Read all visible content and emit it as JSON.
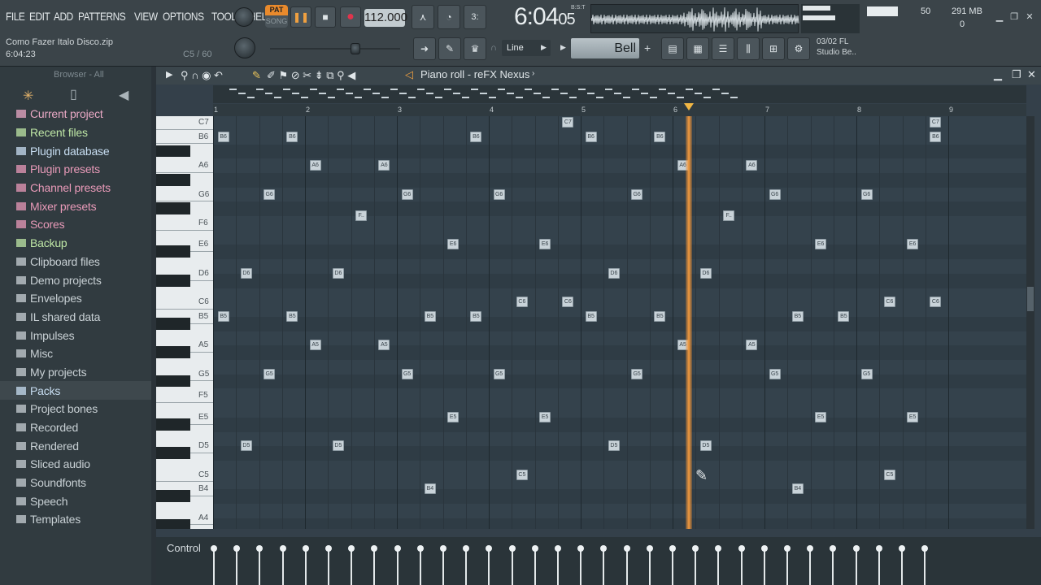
{
  "menu": [
    "FILE",
    "EDIT",
    "ADD",
    "PATTERNS",
    "VIEW",
    "OPTIONS",
    "TOOLS",
    "HELP"
  ],
  "file": {
    "name": "Como Fazer Italo Disco.zip",
    "time": "6:04:23",
    "hint": "C5 / 60"
  },
  "transport": {
    "pat": "PAT",
    "song": "SONG",
    "tempo": "112.000",
    "time_main": "6:04",
    "time_sub": "05",
    "bst": "B:S:T"
  },
  "cpu": {
    "value": "50",
    "memory": "291 MB",
    "poly": "0"
  },
  "snap": "Line",
  "channel": "Bell",
  "news": {
    "date": "03/02",
    "brand": "FL",
    "text": "Studio Be.."
  },
  "browser": {
    "header": "Browser - All",
    "items": [
      {
        "label": "Current project",
        "color": "#e8a8c4",
        "icon": "project-icon"
      },
      {
        "label": "Recent files",
        "color": "#bfe7a6",
        "icon": "folder-icon"
      },
      {
        "label": "Plugin database",
        "color": "#c8def2",
        "icon": "plugin-icon"
      },
      {
        "label": "Plugin presets",
        "color": "#e89ab8",
        "icon": "preset-icon"
      },
      {
        "label": "Channel presets",
        "color": "#e89ab8",
        "icon": "preset-icon"
      },
      {
        "label": "Mixer presets",
        "color": "#e89ab8",
        "icon": "mixer-icon"
      },
      {
        "label": "Scores",
        "color": "#e89ab8",
        "icon": "score-icon"
      },
      {
        "label": "Backup",
        "color": "#bfe7a6",
        "icon": "folder-icon"
      },
      {
        "label": "Clipboard files",
        "color": "#c8d0d4",
        "icon": "folder-icon"
      },
      {
        "label": "Demo projects",
        "color": "#c8d0d4",
        "icon": "folder-icon"
      },
      {
        "label": "Envelopes",
        "color": "#c8d0d4",
        "icon": "folder-icon"
      },
      {
        "label": "IL shared data",
        "color": "#c8d0d4",
        "icon": "folder-icon"
      },
      {
        "label": "Impulses",
        "color": "#c8d0d4",
        "icon": "folder-icon"
      },
      {
        "label": "Misc",
        "color": "#c8d0d4",
        "icon": "folder-icon"
      },
      {
        "label": "My projects",
        "color": "#c8d0d4",
        "icon": "folder-icon"
      },
      {
        "label": "Packs",
        "color": "#c8def2",
        "icon": "pack-icon"
      },
      {
        "label": "Project bones",
        "color": "#c8d0d4",
        "icon": "bones-icon"
      },
      {
        "label": "Recorded",
        "color": "#c8d0d4",
        "icon": "recorded-icon"
      },
      {
        "label": "Rendered",
        "color": "#c8d0d4",
        "icon": "rendered-icon"
      },
      {
        "label": "Sliced audio",
        "color": "#c8d0d4",
        "icon": "sliced-icon"
      },
      {
        "label": "Soundfonts",
        "color": "#c8d0d4",
        "icon": "soundfont-icon"
      },
      {
        "label": "Speech",
        "color": "#c8d0d4",
        "icon": "speech-icon"
      },
      {
        "label": "Templates",
        "color": "#c8d0d4",
        "icon": "template-icon"
      }
    ]
  },
  "pianoroll": {
    "title": "Piano roll - reFX Nexus",
    "ruler": [
      "1",
      "2",
      "3",
      "4",
      "5",
      "6",
      "7",
      "8",
      "9"
    ],
    "key_labels": [
      "C7",
      "B6",
      "A6",
      "G6",
      "F6",
      "E6",
      "D6",
      "C6",
      "B5",
      "A5",
      "G5",
      "F5",
      "E5",
      "D5",
      "C5",
      "B4",
      "A4"
    ],
    "notes": [
      {
        "l": "B6",
        "b": 1.05
      },
      {
        "l": "B6",
        "b": 1.8
      },
      {
        "l": "B6",
        "b": 3.8
      },
      {
        "l": "B6",
        "b": 5.05
      },
      {
        "l": "B6",
        "b": 5.8
      },
      {
        "l": "B6",
        "b": 8.8
      },
      {
        "l": "C7",
        "b": 4.8
      },
      {
        "l": "C7",
        "b": 8.8
      },
      {
        "l": "A6",
        "b": 2.05
      },
      {
        "l": "A6",
        "b": 2.8
      },
      {
        "l": "A6",
        "b": 6.05
      },
      {
        "l": "A6",
        "b": 6.8
      },
      {
        "l": "G6",
        "b": 1.55
      },
      {
        "l": "G6",
        "b": 3.05
      },
      {
        "l": "G6",
        "b": 4.05
      },
      {
        "l": "G6",
        "b": 5.55
      },
      {
        "l": "G6",
        "b": 7.05
      },
      {
        "l": "G6",
        "b": 8.05
      },
      {
        "l": "F..",
        "b": 2.55
      },
      {
        "l": "F..",
        "b": 6.55
      },
      {
        "l": "E6",
        "b": 3.55
      },
      {
        "l": "E6",
        "b": 4.55
      },
      {
        "l": "E6",
        "b": 7.55
      },
      {
        "l": "E6",
        "b": 8.55
      },
      {
        "l": "D6",
        "b": 1.3
      },
      {
        "l": "D6",
        "b": 2.3
      },
      {
        "l": "D6",
        "b": 5.3
      },
      {
        "l": "D6",
        "b": 6.3
      },
      {
        "l": "C6",
        "b": 4.3
      },
      {
        "l": "C6",
        "b": 4.8
      },
      {
        "l": "C6",
        "b": 8.3
      },
      {
        "l": "C6",
        "b": 8.8
      },
      {
        "l": "B5",
        "b": 1.05
      },
      {
        "l": "B5",
        "b": 1.8
      },
      {
        "l": "B5",
        "b": 3.3
      },
      {
        "l": "B5",
        "b": 3.8
      },
      {
        "l": "B5",
        "b": 5.05
      },
      {
        "l": "B5",
        "b": 5.8
      },
      {
        "l": "B5",
        "b": 7.3
      },
      {
        "l": "B5",
        "b": 7.8
      },
      {
        "l": "A5",
        "b": 2.05
      },
      {
        "l": "A5",
        "b": 2.8
      },
      {
        "l": "A5",
        "b": 6.05
      },
      {
        "l": "A5",
        "b": 6.8
      },
      {
        "l": "G5",
        "b": 1.55
      },
      {
        "l": "G5",
        "b": 3.05
      },
      {
        "l": "G5",
        "b": 4.05
      },
      {
        "l": "G5",
        "b": 5.55
      },
      {
        "l": "G5",
        "b": 7.05
      },
      {
        "l": "G5",
        "b": 8.05
      },
      {
        "l": "F..",
        "b": 2.55
      },
      {
        "l": "F..",
        "b": 6.55
      },
      {
        "l": "E5",
        "b": 3.55
      },
      {
        "l": "E5",
        "b": 4.55
      },
      {
        "l": "E5",
        "b": 7.55
      },
      {
        "l": "E5",
        "b": 8.55
      },
      {
        "l": "D5",
        "b": 1.3
      },
      {
        "l": "D5",
        "b": 2.3
      },
      {
        "l": "D5",
        "b": 5.3
      },
      {
        "l": "D5",
        "b": 6.3
      },
      {
        "l": "C5",
        "b": 4.3
      },
      {
        "l": "C5",
        "b": 8.3
      },
      {
        "l": "B4",
        "b": 3.3
      },
      {
        "l": "B4",
        "b": 7.3
      }
    ],
    "note_rows": {
      "C7": 0,
      "B6": 1,
      "A6": 3,
      "G6": 5,
      "F..": 6.5,
      "F6": 7,
      "E6": 8.5,
      "D6": 10.5,
      "C6": 12.5,
      "B5": 13.5,
      "A5": 15.5,
      "G5": 17.5,
      "F5": 19,
      "E5": 20.5,
      "D5": 22.5,
      "C5": 24.5,
      "B4": 25.5,
      "A4": 27.5
    },
    "playhead_bar": 6.2,
    "control_label": "Control",
    "velocity_count": 32
  }
}
